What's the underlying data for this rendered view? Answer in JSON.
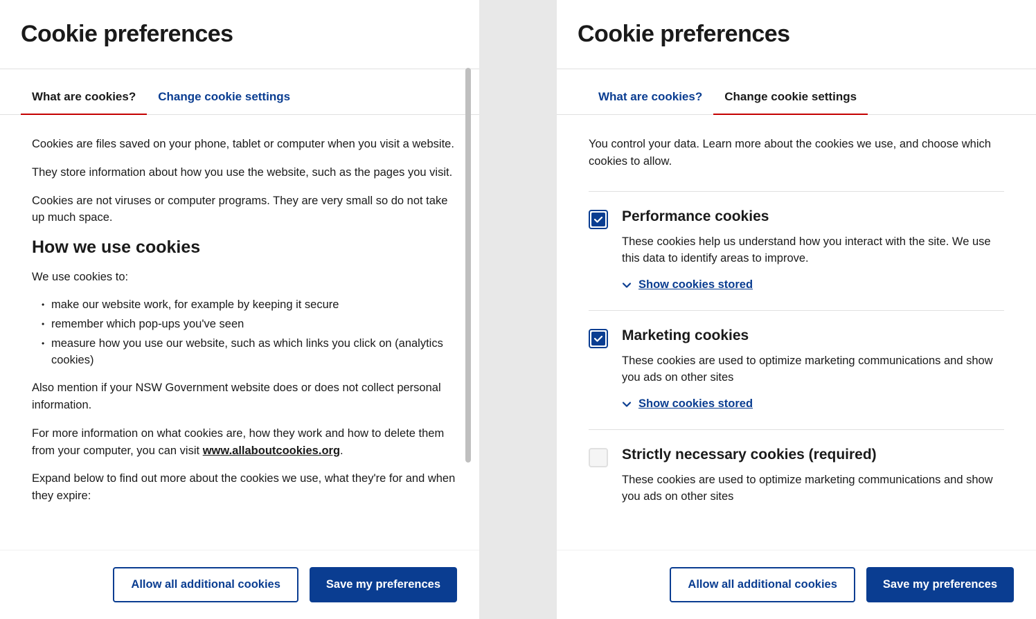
{
  "left": {
    "title": "Cookie preferences",
    "tabs": {
      "whatAre": "What are cookies?",
      "change": "Change cookie settings"
    },
    "para1": "Cookies are files saved on your phone, tablet or computer when you visit a website.",
    "para2": "They store information about how you use the website, such as the pages you visit.",
    "para3": "Cookies are not viruses or computer programs. They are very small so do not take up much space.",
    "heading": "How we use cookies",
    "para4": "We use cookies to:",
    "bullets": {
      "b1": "make our website work, for example by keeping it secure",
      "b2": "remember which pop-ups you've seen",
      "b3": "measure how you use our website, such as which links you click on (analytics cookies)"
    },
    "para5": "Also mention if your NSW Government website does or does not collect personal information.",
    "para6a": "For more information on what cookies are, how they work and how to delete them from your computer, you can visit ",
    "linkText": "www.allaboutcookies.org",
    "para6c": ".",
    "para7": "Expand below to find out more about the cookies we use, what they're for and when they expire:",
    "buttons": {
      "allow": "Allow all additional cookies",
      "save": "Save my preferences"
    }
  },
  "right": {
    "title": "Cookie preferences",
    "tabs": {
      "whatAre": "What are cookies?",
      "change": "Change cookie settings"
    },
    "intro": "You control your data. Learn more about the cookies we use, and choose which cookies to allow.",
    "sections": {
      "performance": {
        "title": "Performance cookies",
        "desc": "These cookies help us understand how you interact with the site. We use this data to identify areas to improve.",
        "show": "Show cookies stored"
      },
      "marketing": {
        "title": "Marketing cookies",
        "desc": "These cookies are used to optimize marketing communications and show you ads on other sites",
        "show": "Show cookies stored"
      },
      "necessary": {
        "title": "Strictly necessary cookies (required)",
        "desc": "These cookies are used to optimize marketing communications and show you ads on other sites"
      }
    },
    "buttons": {
      "allow": "Allow all additional cookies",
      "save": "Save my preferences"
    }
  }
}
